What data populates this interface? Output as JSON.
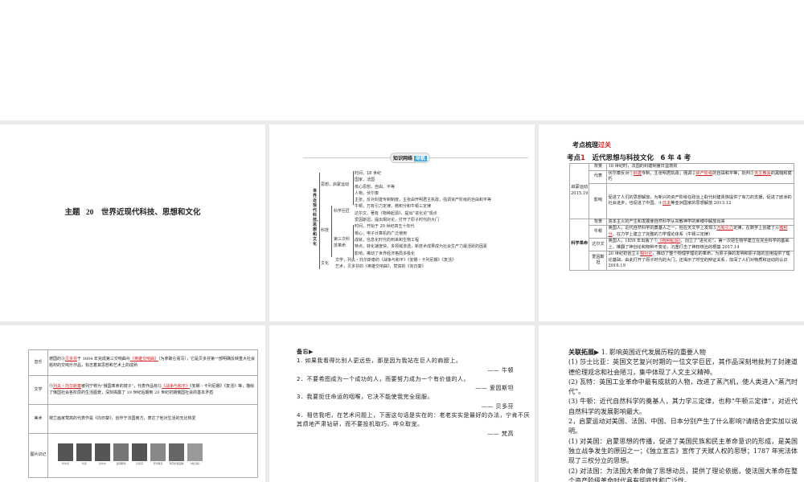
{
  "slide1": {
    "title": "主题 20　世界近现代科技、思想和文化"
  },
  "slide2": {
    "header": "知识网络",
    "header_accent": "导航",
    "root": "世界近现代科技、思想和文化",
    "branches": [
      "思想",
      "启蒙运动",
      "科技",
      "科学巨匠",
      "第三次科技革命",
      "文化"
    ],
    "lines": [
      "时间，18 世纪",
      "国家，法国",
      "核心思想，自由、平等",
      "人物，伏尔泰",
      "主张，反对封建专制制度，主张由开明君主执政，强调资产阶级的自由和平等",
      "牛顿，万有引力定律，微积分和牛顿三定律",
      "达尔文，著有《物种起源》，提出“进化论”观点",
      "爱因斯坦，提出相对论，打开了原子时代的大门",
      "时间，开始于 20 世纪四五十年代",
      "核心，电子计算机的广泛使用",
      "成就，信息化时代的到来和生物工程",
      "特点，转化速度快，多领域渗透，新技术成果成为社会生产力最活跃的因素",
      "影响，推动了世界经济格局多极化",
      "文学，列夫・托尔斯泰的《战争与和平》《安娜・卡列尼娜》《复活》",
      "艺术，贝多芬的《英雄交响曲》，梵高的《向日葵》"
    ]
  },
  "slide3": {
    "heading": "考点梳理",
    "heading_accent": "过关",
    "sub_a": "考点",
    "sub_num": "1",
    "sub_b": "近代思想与科技文化　6 年 4 考",
    "g1": "启蒙运动2015.19",
    "g2": "科学革命",
    "rows": [
      {
        "k": "背景",
        "v": "18 世纪时，法国的封建制度日益衰败"
      },
      {
        "k": "代表",
        "pre": "伏尔泰反对①",
        "a1": "封建",
        "mid": "专制，主张明君执政；强调②",
        "a2": "资产阶级",
        "mid2": "的自由和平等；批判③",
        "a3": "天主教会",
        "post": "的黑暗和腐朽"
      },
      {
        "k": "影响",
        "pre": "促进了人们的思想解放，为新兴的资产阶级在政治上取代封建贵族提供了有力的支援，促进了欧洲的社会进步，也促进了中国、④",
        "a1": "日本",
        "post": "等亚洲国家的思想解放 2013.12"
      },
      {
        "k": "背景",
        "v": "资本主义的产生和发展使自然科学从宗教神学的束缚中解放出来"
      },
      {
        "k": "牛顿",
        "pre": "英国人，近代自然科学的奠基人之一，他在天文学上发现⑤",
        "a1": "万有引力",
        "mid": "定律，在数学上创建了⑥",
        "a2": "微积分",
        "post": "，在力学上建立了完整的力学理论体系（牛顿三定律）"
      },
      {
        "k": "达尔文",
        "pre": "英国人，1859 年出版了⑦",
        "a1": "《物种起源》",
        "post": "，创立了“进化论”，第一次把生物学建立在完全科学的基础上，推翻了神创论和物种不变论，沉重打击了神权统治的根基 2017.14"
      },
      {
        "k": "爱因斯坦",
        "pre": "20 世纪初创立⑧",
        "a1": "相对论",
        "post": "，推动了整个物理学理论的革命，为原子弹的发明和原子能的应用提供了理论基础，由此打开了原子时代的大门；还揭示了时空的辩证关系，加深了人们对物质和运动的认识 2016.19"
      }
    ]
  },
  "slide4": {
    "rows": [
      {
        "k": "音乐",
        "pre": "德国的⑨",
        "a1": "贝多芬",
        "mid": "于 1804 年完成第三交响曲⑩",
        "a2": "《英雄交响曲》",
        "post": "（为拿破仑而写），它是贝多芬第一部明确反映重大社会题材的交响乐作品，标志着其思想和艺术上的成熟"
      },
      {
        "k": "文学",
        "pre": "⑪",
        "a1": "列夫・托尔斯泰",
        "mid": "被列宁称为“俄国革命的镜子”，代表作品有⑫",
        "a2": "《战争与和平》",
        "post": "《安娜・卡列尼娜》《复活》等，描绘了俄国社会各阶层的生活图景，深刻揭露了 19 世纪后期到 20 世纪初期俄国社会的基本矛盾"
      },
      {
        "k": "美术",
        "v": "荷兰画家梵高的代表作是《向日葵》，创作于法国南方，表达了他对生活的无比热爱"
      },
      {
        "k": "图片识记",
        "captions": [
          "伏尔泰",
          "牛顿",
          "达尔文",
          "爱因斯坦",
          "贝多芬",
          "托尔斯泰",
          "梵高的自画像",
          "《向日葵》"
        ]
      }
    ]
  },
  "slide5": {
    "heading": "备忘▶",
    "quotes": [
      {
        "text": "1. 如果我看得比别人更远些，那是因为我站在巨人的肩膀上。",
        "by": "—— 牛顿"
      },
      {
        "text": "2．不要希图成为一个成功的人，而要努力成为一个有价值的人。",
        "by": "—— 爱因斯坦"
      },
      {
        "text": "3．我要扼住命运的咽喉，它决不能使我完全屈服。",
        "by": "—— 贝多芬"
      },
      {
        "text": "4．相信我吧，在艺术问题上，下面这句话是实在的：老老实实是最好的办法，宁肯不厌其烦地严肃钻研，而不要投机取巧、哗众取宠。",
        "by": "—— 梵高"
      }
    ]
  },
  "slide6": {
    "heading": "关联拓展▶",
    "paras": [
      "1. 影响英国近代发展历程的重要人物",
      "(1) 莎士比亚：英国文艺复兴时期的一位文学巨匠，其作品深刻地批判了封建道德伦理观念和社会陋习，集中体现了人文主义精神。",
      "(2) 瓦特：英国工业革命中最有成就的人物，改进了蒸汽机，使人类进入“蒸汽时代”。",
      "(3) 牛顿：近代自然科学的奠基人，其力学三定律，也称“牛顿三定律”，对近代自然科学的发展影响最大。",
      "2，启蒙运动对美国、法国、中国、日本分别产生了什么影响?请结合史实加以说明。",
      "(1) 对美国：启蒙思想的传播，促进了美国民族和民主革命意识的形成，是美国独立战争发生的原因之一；《独立宣言》宣传了天赋人权的思想；1787 年宪法体现了三权分立的思想。",
      "(2) 对法国：为法国大革命做了思想动员，提供了理论依据，使法国大革命在整个资产阶级革命时代具有彻底性和广泛性。"
    ]
  }
}
